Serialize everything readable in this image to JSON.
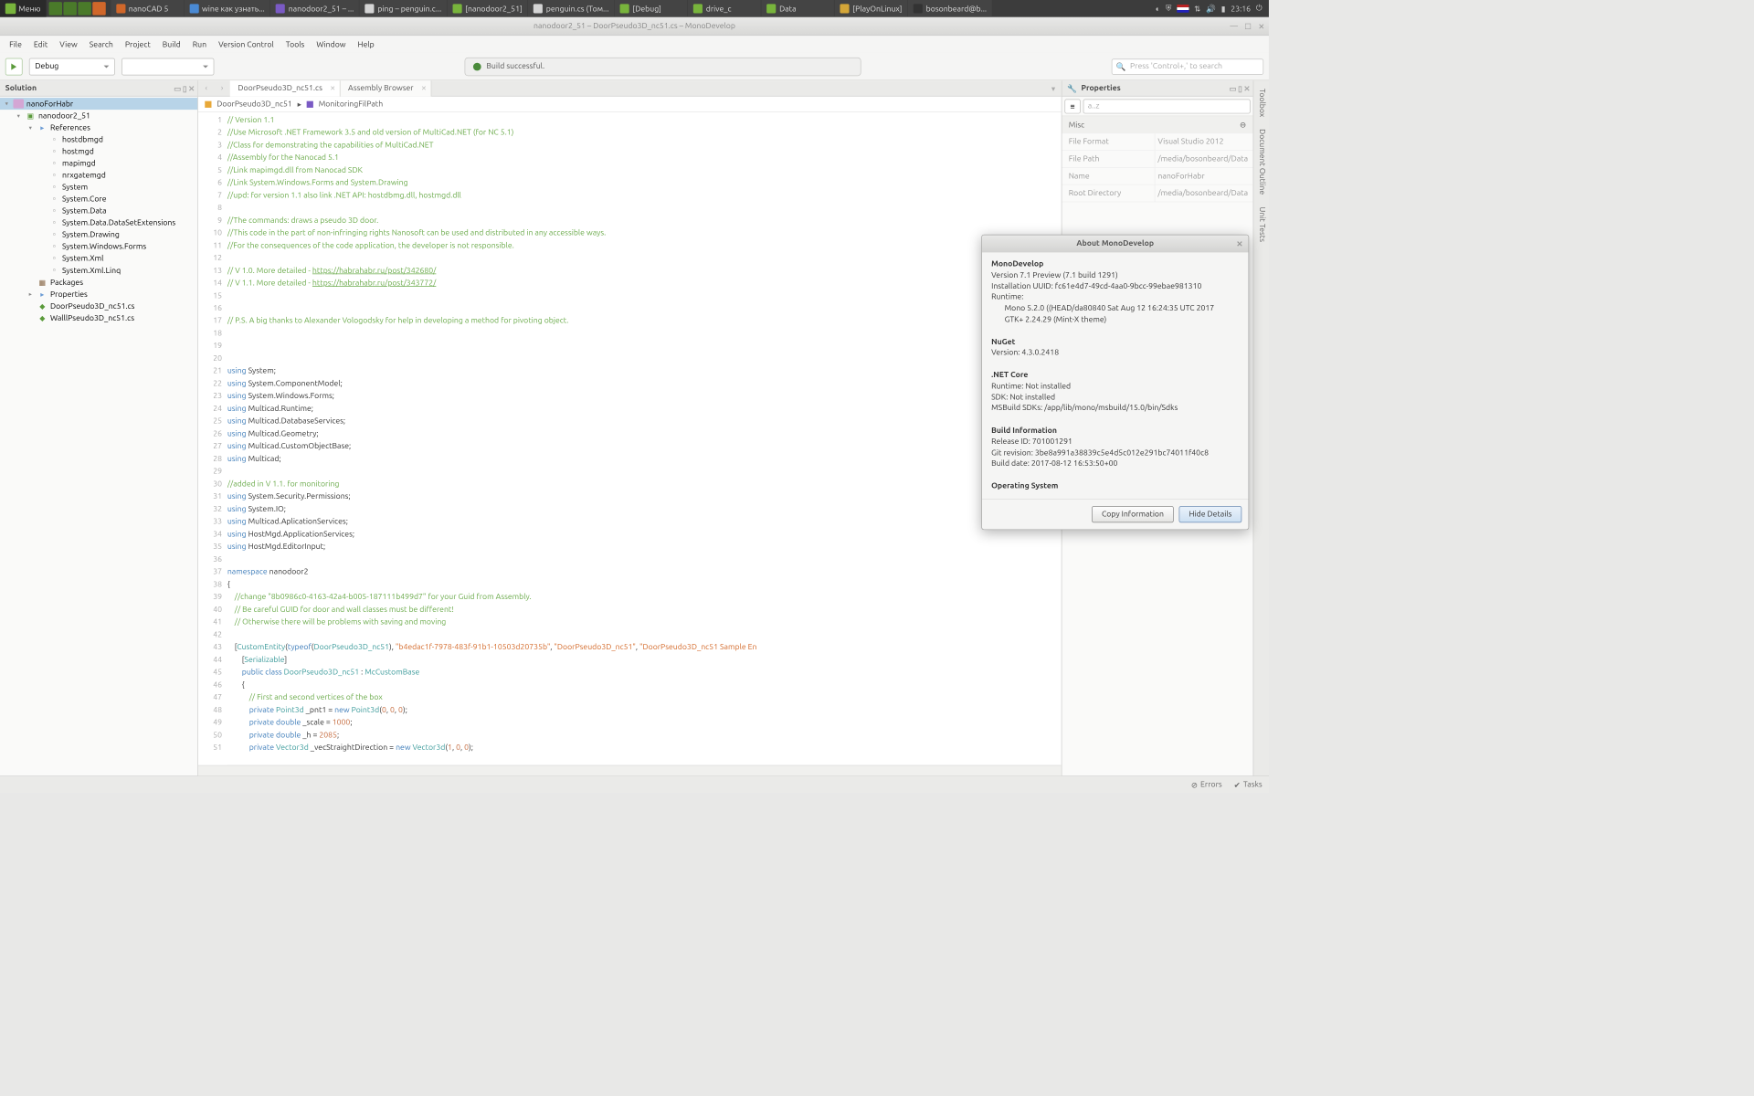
{
  "taskbar": {
    "menu": "Меню",
    "tasks": [
      {
        "label": "nanoCAD 5",
        "color": "#d0672a"
      },
      {
        "label": "wine как узнать...",
        "color": "#4a8ad4"
      },
      {
        "label": "nanodoor2_51 – ...",
        "color": "#7a5ac4"
      },
      {
        "label": "ping – penguin.c...",
        "color": "#d4d4d4"
      },
      {
        "label": "[nanodoor2_51]",
        "color": "#78b43c"
      },
      {
        "label": "penguin.cs (Том...",
        "color": "#d4d4d4"
      },
      {
        "label": "[Debug]",
        "color": "#78b43c"
      },
      {
        "label": "drive_c",
        "color": "#78b43c"
      },
      {
        "label": "Data",
        "color": "#78b43c"
      },
      {
        "label": "[PlayOnLinux]",
        "color": "#d4a638"
      },
      {
        "label": "bosonbeard@b...",
        "color": "#333"
      }
    ],
    "time": "23:16"
  },
  "window": {
    "title": "nanodoor2_51 – DoorPseudo3D_nc51.cs – MonoDevelop"
  },
  "menubar": [
    "File",
    "Edit",
    "View",
    "Search",
    "Project",
    "Build",
    "Run",
    "Version Control",
    "Tools",
    "Window",
    "Help"
  ],
  "toolbar": {
    "config": "Debug",
    "build_status": "Build successful.",
    "search_placeholder": "Press 'Control+,' to search"
  },
  "solution": {
    "title": "Solution",
    "root": "nanoForHabr",
    "project": "nanodoor2_51",
    "refs_label": "References",
    "refs": [
      "hostdbmgd",
      "hostmgd",
      "mapimgd",
      "nrxgatemgd",
      "System",
      "System.Core",
      "System.Data",
      "System.Data.DataSetExtensions",
      "System.Drawing",
      "System.Windows.Forms",
      "System.Xml",
      "System.Xml.Linq"
    ],
    "packages": "Packages",
    "properties": "Properties",
    "files": [
      "DoorPseudo3D_nc51.cs",
      "WalllPseudo3D_nc51.cs"
    ]
  },
  "editor": {
    "tabs": [
      {
        "label": "DoorPseudo3D_nc51.cs",
        "active": true
      },
      {
        "label": "Assembly Browser",
        "active": false
      }
    ],
    "crumb1": "DoorPseudo3D_nc51",
    "crumb2": "MonitoringFilPath"
  },
  "properties": {
    "title": "Properties",
    "filter": "a..z",
    "section": "Misc",
    "rows": [
      {
        "k": "File Format",
        "v": "Visual Studio 2012"
      },
      {
        "k": "File Path",
        "v": "/media/bosonbeard/Data"
      },
      {
        "k": "Name",
        "v": "nanoForHabr"
      },
      {
        "k": "Root Directory",
        "v": "/media/bosonbeard/Data"
      }
    ]
  },
  "rightstrip": [
    "Toolbox",
    "Document Outline",
    "Unit Tests"
  ],
  "about": {
    "title": "About MonoDevelop",
    "h1": "MonoDevelop",
    "version": "Version 7.1 Preview (7.1 build 1291)",
    "uuid": "Installation UUID: fc61e4d7-49cd-4aa0-9bcc-99ebae981310",
    "runtime": "Runtime:",
    "mono": "Mono 5.2.0 ((HEAD/da80840 Sat Aug 12 16:24:35 UTC 2017",
    "gtk": "GTK+ 2.24.29 (Mint-X theme)",
    "h2": "NuGet",
    "nuget_ver": "Version: 4.3.0.2418",
    "h3": ".NET Core",
    "nc_runtime": "Runtime: Not installed",
    "nc_sdk": "SDK: Not installed",
    "nc_msbuild": "MSBuild SDKs: /app/lib/mono/msbuild/15.0/bin/Sdks",
    "h4": "Build Information",
    "release": "Release ID: 701001291",
    "git": "Git revision: 3be8a991a38839c5e4d5c012e291bc74011f40c8",
    "bdate": "Build date: 2017-08-12 16:53:50+00",
    "h5": "Operating System",
    "btn_copy": "Copy Information",
    "btn_hide": "Hide Details"
  },
  "statusbar": {
    "errors": "Errors",
    "tasks": "Tasks"
  },
  "code_lines": [
    {
      "n": 1,
      "h": "<span class='c-comment'>// Version 1.1</span>"
    },
    {
      "n": 2,
      "h": "<span class='c-comment'>//Use Microsoft .NET Framework 3.5 and old version of MultiCad.NET (for NC 5.1)</span>"
    },
    {
      "n": 3,
      "h": "<span class='c-comment'>//Class for demonstrating the capabilities of MultiCad.NET</span>"
    },
    {
      "n": 4,
      "h": "<span class='c-comment'>//Assembly for the Nanocad 5.1</span>"
    },
    {
      "n": 5,
      "h": "<span class='c-comment'>//Link mapimgd.dll from Nanocad SDK</span>"
    },
    {
      "n": 6,
      "h": "<span class='c-comment'>//Link System.Windows.Forms and System.Drawing</span>"
    },
    {
      "n": 7,
      "h": "<span class='c-comment'>//upd: for version 1.1 also link .NET API: hostdbmg.dll, hostmgd.dll</span>"
    },
    {
      "n": 8,
      "h": ""
    },
    {
      "n": 9,
      "h": "<span class='c-comment'>//The commands: draws a pseudo 3D door.</span>"
    },
    {
      "n": 10,
      "h": "<span class='c-comment'>//This code in the part of non-infringing rights Nanosoft can be used and distributed in any accessible ways.</span>"
    },
    {
      "n": 11,
      "h": "<span class='c-comment'>//For the consequences of the code application, the developer is not responsible.</span>"
    },
    {
      "n": 12,
      "h": ""
    },
    {
      "n": 13,
      "h": "<span class='c-comment'>// V 1.0. More detailed - </span><span class='c-link'>https://habrahabr.ru/post/342680/</span>"
    },
    {
      "n": 14,
      "h": "<span class='c-comment'>// V 1.1. More detailed - </span><span class='c-link'>https://habrahabr.ru/post/343772/</span>"
    },
    {
      "n": 15,
      "h": ""
    },
    {
      "n": 16,
      "h": ""
    },
    {
      "n": 17,
      "h": "<span class='c-comment'>// P.S. A big thanks to Alexander Vologodsky for help in developing a method for pivoting object.</span>"
    },
    {
      "n": 18,
      "h": ""
    },
    {
      "n": 19,
      "h": ""
    },
    {
      "n": 20,
      "h": ""
    },
    {
      "n": 21,
      "h": "<span class='c-key'>using</span> System;"
    },
    {
      "n": 22,
      "h": "<span class='c-key'>using</span> System.ComponentModel;"
    },
    {
      "n": 23,
      "h": "<span class='c-key'>using</span> System.Windows.Forms;"
    },
    {
      "n": 24,
      "h": "<span class='c-key'>using</span> Multicad.Runtime;"
    },
    {
      "n": 25,
      "h": "<span class='c-key'>using</span> Multicad.DatabaseServices;"
    },
    {
      "n": 26,
      "h": "<span class='c-key'>using</span> Multicad.Geometry;"
    },
    {
      "n": 27,
      "h": "<span class='c-key'>using</span> Multicad.CustomObjectBase;"
    },
    {
      "n": 28,
      "h": "<span class='c-key'>using</span> Multicad;"
    },
    {
      "n": 29,
      "h": ""
    },
    {
      "n": 30,
      "h": "<span class='c-comment'>//added in V 1.1. for monitoring</span>"
    },
    {
      "n": 31,
      "h": "<span class='c-key'>using</span> System.Security.Permissions;"
    },
    {
      "n": 32,
      "h": "<span class='c-key'>using</span> System.IO;"
    },
    {
      "n": 33,
      "h": "<span class='c-key'>using</span> Multicad.AplicationServices;"
    },
    {
      "n": 34,
      "h": "<span class='c-key'>using</span> HostMgd.ApplicationServices;"
    },
    {
      "n": 35,
      "h": "<span class='c-key'>using</span> HostMgd.EditorInput;"
    },
    {
      "n": 36,
      "h": ""
    },
    {
      "n": 37,
      "h": "<span class='c-key'>namespace</span> nanodoor2"
    },
    {
      "n": 38,
      "h": "{"
    },
    {
      "n": 39,
      "h": "    <span class='c-comment'>//change \"8b0986c0-4163-42a4-b005-187111b499d7\" for your Guid from Assembly.</span>"
    },
    {
      "n": 40,
      "h": "    <span class='c-comment'>// Be careful GUID for door and wall classes must be different!</span>"
    },
    {
      "n": 41,
      "h": "    <span class='c-comment'>// Otherwise there will be problems with saving and moving</span>"
    },
    {
      "n": 42,
      "h": ""
    },
    {
      "n": 43,
      "h": "    [<span class='c-type'>CustomEntity</span>(<span class='c-key'>typeof</span>(<span class='c-type'>DoorPseudo3D_nc51</span>), <span class='c-str'>\"b4edac1f-7978-483f-91b1-10503d20735b\"</span>, <span class='c-str'>\"DoorPseudo3D_nc51\"</span>, <span class='c-str'>\"DoorPseudo3D_nc51 Sample En</span>"
    },
    {
      "n": 44,
      "h": "        [<span class='c-type'>Serializable</span>]"
    },
    {
      "n": 45,
      "h": "        <span class='c-key'>public</span> <span class='c-key'>class</span> <span class='c-type'>DoorPseudo3D_nc51</span> : <span class='c-type'>McCustomBase</span>"
    },
    {
      "n": 46,
      "h": "        {"
    },
    {
      "n": 47,
      "h": "            <span class='c-comment'>// First and second vertices of the box</span>"
    },
    {
      "n": 48,
      "h": "            <span class='c-key'>private</span> <span class='c-type'>Point3d</span> _pnt1 = <span class='c-key'>new</span> <span class='c-type'>Point3d</span>(<span class='c-num'>0</span>, <span class='c-num'>0</span>, <span class='c-num'>0</span>);"
    },
    {
      "n": 49,
      "h": "            <span class='c-key'>private</span> <span class='c-key'>double</span> _scale = <span class='c-num'>1000</span>;"
    },
    {
      "n": 50,
      "h": "            <span class='c-key'>private</span> <span class='c-key'>double</span> _h = <span class='c-num'>2085</span>;"
    },
    {
      "n": 51,
      "h": "            <span class='c-key'>private</span> <span class='c-type'>Vector3d</span> _vecStraightDirection = <span class='c-key'>new</span> <span class='c-type'>Vector3d</span>(<span class='c-num'>1</span>, <span class='c-num'>0</span>, <span class='c-num'>0</span>);"
    }
  ]
}
